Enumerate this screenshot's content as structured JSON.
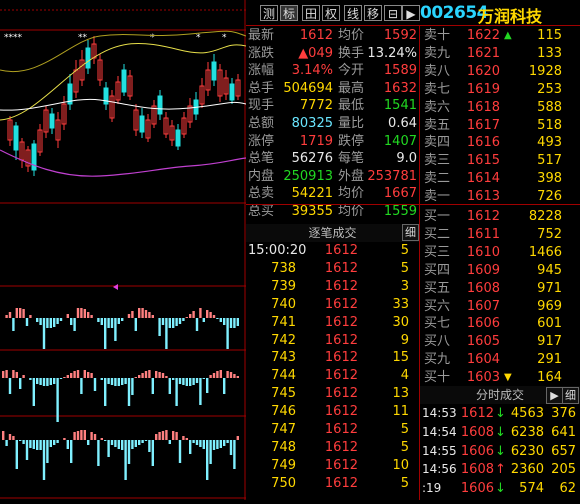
{
  "toolbar": {
    "buttons": [
      "测",
      "标",
      "田",
      "权",
      "线",
      "移",
      "⊟",
      "▶"
    ]
  },
  "stock": {
    "code": "002654",
    "name": "万润科技"
  },
  "sell_levels": [
    {
      "label": "卖十",
      "price": "1622",
      "vol": "115",
      "arrow": "▲"
    },
    {
      "label": "卖九",
      "price": "1621",
      "vol": "133",
      "arrow": ""
    },
    {
      "label": "卖八",
      "price": "1620",
      "vol": "1928",
      "arrow": ""
    },
    {
      "label": "卖七",
      "price": "1619",
      "vol": "253",
      "arrow": ""
    },
    {
      "label": "卖六",
      "price": "1618",
      "vol": "588",
      "arrow": ""
    },
    {
      "label": "卖五",
      "price": "1617",
      "vol": "518",
      "arrow": ""
    },
    {
      "label": "卖四",
      "price": "1616",
      "vol": "493",
      "arrow": ""
    },
    {
      "label": "卖三",
      "price": "1615",
      "vol": "517",
      "arrow": ""
    },
    {
      "label": "卖二",
      "price": "1614",
      "vol": "398",
      "arrow": ""
    },
    {
      "label": "卖一",
      "price": "1613",
      "vol": "726",
      "arrow": ""
    }
  ],
  "buy_levels": [
    {
      "label": "买一",
      "price": "1612",
      "vol": "8228",
      "arrow": ""
    },
    {
      "label": "买二",
      "price": "1611",
      "vol": "752",
      "arrow": ""
    },
    {
      "label": "买三",
      "price": "1610",
      "vol": "1466",
      "arrow": ""
    },
    {
      "label": "买四",
      "price": "1609",
      "vol": "945",
      "arrow": ""
    },
    {
      "label": "买五",
      "price": "1608",
      "vol": "971",
      "arrow": ""
    },
    {
      "label": "买六",
      "price": "1607",
      "vol": "969",
      "arrow": ""
    },
    {
      "label": "买七",
      "price": "1606",
      "vol": "601",
      "arrow": ""
    },
    {
      "label": "买八",
      "price": "1605",
      "vol": "917",
      "arrow": ""
    },
    {
      "label": "买九",
      "price": "1604",
      "vol": "291",
      "arrow": ""
    },
    {
      "label": "买十",
      "price": "1603",
      "vol": "164",
      "arrow": "▼"
    }
  ],
  "quote": [
    {
      "l1": "最新",
      "v1": "1612",
      "c1": "red",
      "l2": "均价",
      "v2": "1592",
      "c2": "red"
    },
    {
      "l1": "涨跌",
      "v1": "▲049",
      "c1": "red",
      "l2": "换手",
      "v2": "13.24%",
      "c2": "wht"
    },
    {
      "l1": "涨幅",
      "v1": "3.14%",
      "c1": "red",
      "l2": "今开",
      "v2": "1589",
      "c2": "red"
    },
    {
      "l1": "总手",
      "v1": "504694",
      "c1": "yel",
      "l2": "最高",
      "v2": "1632",
      "c2": "red"
    },
    {
      "l1": "现手",
      "v1": "7772",
      "c1": "yel",
      "l2": "最低",
      "v2": "1541",
      "c2": "grn"
    },
    {
      "l1": "总额",
      "v1": "80325",
      "c1": "cyan",
      "l2": "量比",
      "v2": "0.64",
      "c2": "wht"
    },
    {
      "l1": "涨停",
      "v1": "1719",
      "c1": "red",
      "l2": "跌停",
      "v2": "1407",
      "c2": "grn"
    },
    {
      "l1": "总笔",
      "v1": "56276",
      "c1": "wht",
      "l2": "每笔",
      "v2": "9.0",
      "c2": "wht"
    },
    {
      "l1": "内盘",
      "v1": "250913",
      "c1": "grn",
      "l2": "外盘",
      "v2": "253781",
      "c2": "red"
    },
    {
      "l1": "总卖",
      "v1": "54221",
      "c1": "yel",
      "l2": "均价",
      "v2": "1667",
      "c2": "red"
    },
    {
      "l1": "总买",
      "v1": "39355",
      "c1": "yel",
      "l2": "均价",
      "v2": "1559",
      "c2": "grn"
    }
  ],
  "tick_panel": {
    "title": "逐笔成交",
    "detail_btn": "细",
    "time": "15:00:20",
    "rows": [
      {
        "vol": "",
        "price": "1612",
        "cnt": "5"
      },
      {
        "vol": "738",
        "price": "1612",
        "cnt": "5"
      },
      {
        "vol": "739",
        "price": "1612",
        "cnt": "3"
      },
      {
        "vol": "740",
        "price": "1612",
        "cnt": "33"
      },
      {
        "vol": "741",
        "price": "1612",
        "cnt": "30"
      },
      {
        "vol": "742",
        "price": "1612",
        "cnt": "9"
      },
      {
        "vol": "743",
        "price": "1612",
        "cnt": "15"
      },
      {
        "vol": "744",
        "price": "1612",
        "cnt": "4"
      },
      {
        "vol": "745",
        "price": "1612",
        "cnt": "13"
      },
      {
        "vol": "746",
        "price": "1612",
        "cnt": "11"
      },
      {
        "vol": "747",
        "price": "1612",
        "cnt": "5"
      },
      {
        "vol": "748",
        "price": "1612",
        "cnt": "5"
      },
      {
        "vol": "749",
        "price": "1612",
        "cnt": "10"
      },
      {
        "vol": "750",
        "price": "1612",
        "cnt": "5"
      }
    ]
  },
  "minute_panel": {
    "title": "分时成交",
    "play_btn": "▶",
    "detail_btn": "细",
    "rows": [
      {
        "time": "14:53",
        "price": "1612",
        "dir": "↓",
        "vol": "4563",
        "cnt": "376"
      },
      {
        "time": "14:54",
        "price": "1608",
        "dir": "↓",
        "vol": "6238",
        "cnt": "641"
      },
      {
        "time": "14:55",
        "price": "1606",
        "dir": "↓",
        "vol": "6230",
        "cnt": "657"
      },
      {
        "time": "14:56",
        "price": "1608",
        "dir": "↑",
        "vol": "2360",
        "cnt": "205"
      },
      {
        "time": ":19",
        "price": "1606",
        "dir": "↓",
        "vol": "574",
        "cnt": "62"
      }
    ]
  },
  "chart_marks": {
    "star_groups": [
      "****",
      "**",
      "*",
      "*",
      "*"
    ]
  },
  "colors": {
    "up": "#ff3d3d",
    "down": "#22d822",
    "frame": "#a00000",
    "code": "#2ad5ff",
    "name": "#ffd800"
  }
}
